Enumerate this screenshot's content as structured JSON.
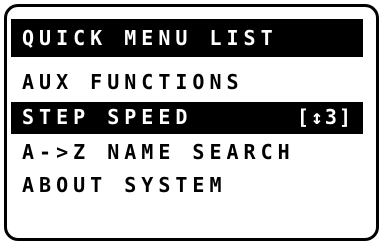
{
  "menu": {
    "title": "QUICK MENU LIST",
    "items": [
      {
        "label": "AUX FUNCTIONS",
        "value": ""
      },
      {
        "label": "STEP SPEED",
        "value": "[↕3]",
        "selected": true
      },
      {
        "label": "A->Z NAME SEARCH",
        "value": ""
      },
      {
        "label": "ABOUT SYSTEM",
        "value": ""
      }
    ]
  },
  "colors": {
    "foreground": "#000000",
    "background": "#ffffff"
  }
}
